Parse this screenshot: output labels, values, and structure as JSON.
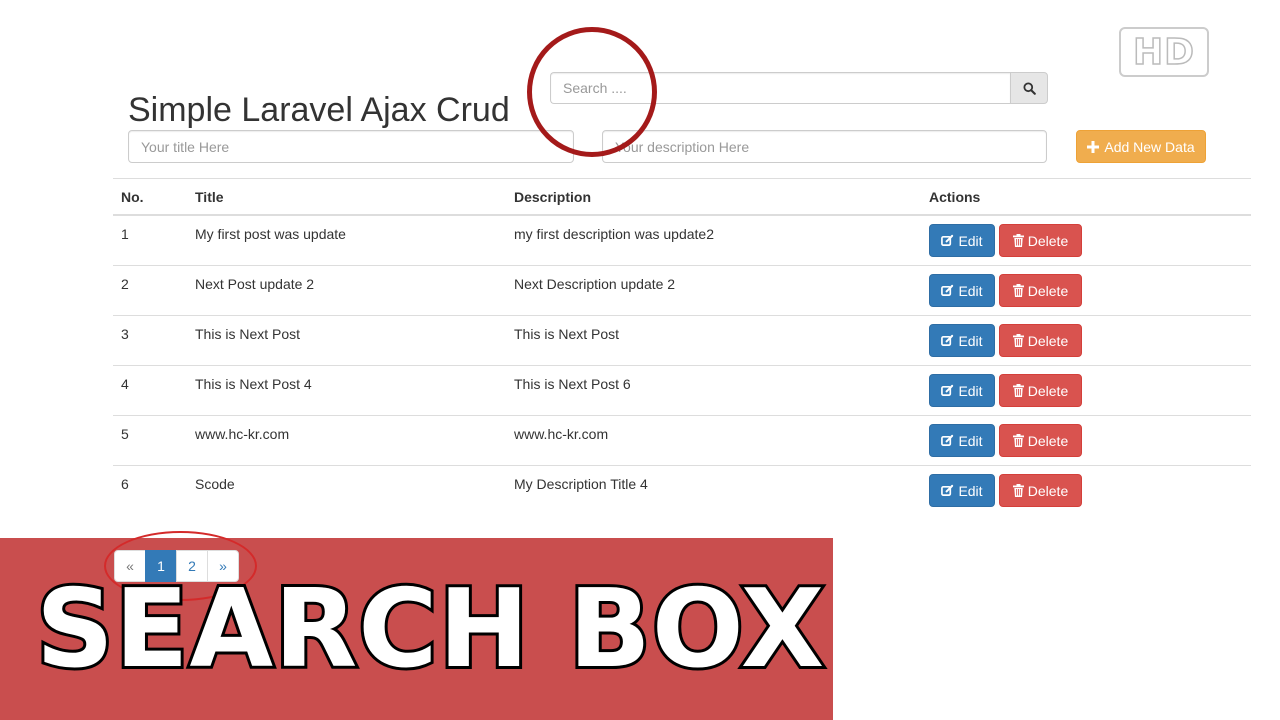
{
  "page": {
    "title": "Simple Laravel Ajax Crud"
  },
  "search": {
    "placeholder": "Search ...."
  },
  "form": {
    "title_placeholder": "Your title Here",
    "description_placeholder": "Your description Here",
    "add_label": "Add New Data"
  },
  "table": {
    "headers": {
      "no": "No.",
      "title": "Title",
      "description": "Description",
      "actions": "Actions"
    },
    "edit_label": "Edit",
    "delete_label": "Delete",
    "rows": [
      {
        "no": "1",
        "title": "My first post was update",
        "description": "my first description was update2"
      },
      {
        "no": "2",
        "title": "Next Post update 2",
        "description": "Next Description update 2"
      },
      {
        "no": "3",
        "title": "This is Next Post",
        "description": "This is Next Post"
      },
      {
        "no": "4",
        "title": "This is Next Post 4",
        "description": "This is Next Post 6"
      },
      {
        "no": "5",
        "title": "www.hc-kr.com",
        "description": "www.hc-kr.com"
      },
      {
        "no": "6",
        "title": "Scode",
        "description": "My Description Title 4"
      }
    ]
  },
  "pagination": {
    "prev": "«",
    "pages": [
      "1",
      "2"
    ],
    "active": "1",
    "next": "»"
  },
  "overlay": {
    "banner_text": "SEARCH BOX",
    "hd_badge": "HD"
  },
  "colors": {
    "edit": "#337ab7",
    "delete": "#d9534f",
    "add": "#f0ad4e",
    "banner": "#c13434",
    "highlight_circle": "#a41a1a"
  },
  "icons": {
    "search": "search-icon",
    "add": "plus-icon",
    "edit": "edit-icon",
    "delete": "trash-icon"
  }
}
